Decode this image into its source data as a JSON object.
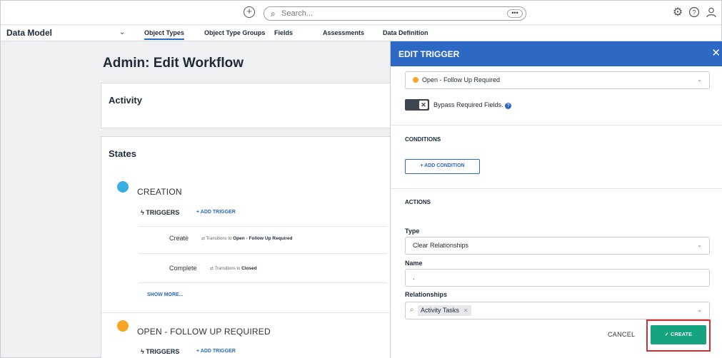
{
  "topbar": {
    "search_placeholder": "Search...",
    "more_label": "•••"
  },
  "nav": {
    "model_label": "Data Model",
    "tabs": [
      {
        "label": "Object Types"
      },
      {
        "label": "Object Type Groups"
      },
      {
        "label": "Fields"
      },
      {
        "label": "Assessments"
      },
      {
        "label": "Data Definition"
      }
    ]
  },
  "page": {
    "title": "Admin: Edit Workflow",
    "activity_title": "Activity",
    "states_title": "States",
    "states": [
      {
        "name": "CREATION",
        "color": "#3aaee0",
        "triggers_label": "TRIGGERS",
        "add_trigger_label": "+ ADD TRIGGER",
        "triggers": [
          {
            "name": "Create",
            "transition_text": "Transitions to",
            "target": "Open - Follow Up Required"
          },
          {
            "name": "Complete",
            "transition_text": "Transitions to",
            "target": "Closed"
          }
        ],
        "show_more_label": "SHOW MORE..."
      },
      {
        "name": "OPEN - FOLLOW UP REQUIRED",
        "color": "#f5a623",
        "triggers_label": "TRIGGERS",
        "add_trigger_label": "+ ADD TRIGGER"
      }
    ]
  },
  "drawer": {
    "title": "EDIT TRIGGER",
    "state_select": "Open - Follow Up Required",
    "bypass_label": "Bypass Required Fields.",
    "conditions_title": "CONDITIONS",
    "add_condition_label": "+ ADD CONDITION",
    "actions_title": "ACTIONS",
    "type_label": "Type",
    "type_value": "Clear Relationships",
    "name_label": "Name",
    "name_value": ".",
    "relationships_label": "Relationships",
    "relationships_chip": "Activity Tasks",
    "cancel_label": "CANCEL",
    "create_label": "✓ CREATE"
  },
  "colors": {
    "accent": "#2d68c4",
    "create": "#16a37f",
    "highlight": "#d32f2f"
  }
}
